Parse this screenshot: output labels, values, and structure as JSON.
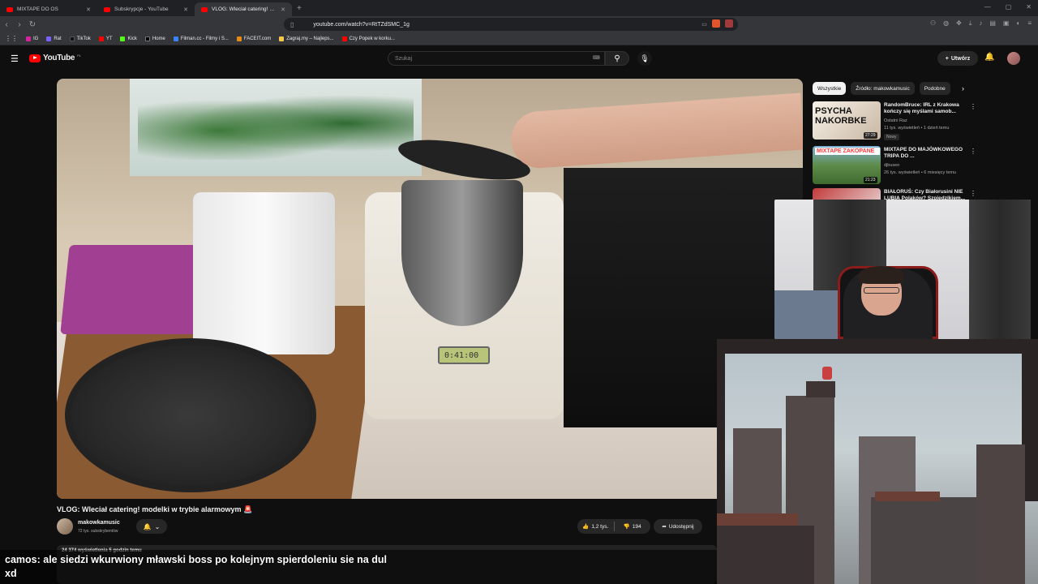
{
  "browser": {
    "tabs": [
      {
        "label": "MIXTAPE DO OS",
        "active": false
      },
      {
        "label": "Subskrypcje - YouTube",
        "active": false
      },
      {
        "label": "VLOG: Wleciał catering! mod...",
        "active": true
      }
    ],
    "url": "youtube.com/watch?v=RtTZdSMC_1g",
    "bookmarks": [
      "IG",
      "Rat",
      "TikTok",
      "YT",
      "Kick",
      "Home",
      "Filman.cc - Filmy i S...",
      "FACEIT.com",
      "Zagraj.my – Najleps...",
      "Czy Popek w korku..."
    ]
  },
  "youtube": {
    "logo": "YouTube",
    "country": "PL",
    "search_placeholder": "Szukaj",
    "create_label": "Utwórz"
  },
  "video": {
    "title": "VLOG: Wleciał catering! modelki w trybie alarmowym 🚨",
    "channel": "makowkamusic",
    "subscribers": "72 tys. subskrybentów",
    "likes": "1,2 tys.",
    "dislikes": "194",
    "share_label": "Udostępnij",
    "meta": "24 374 wyświetlenia  5 godzin temu",
    "display_readout": "0:41:00"
  },
  "sidebar": {
    "chips": [
      "Wszystkie",
      "Źródło: makowkamusic",
      "Podobne"
    ],
    "recommendations": [
      {
        "title": "RandomBruce: IRL z Krakowa kończy się myślami samob...",
        "channel": "Ostatni Raz",
        "meta": "11 tys. wyświetleń • 1 dzień temu",
        "badge": "Nowy",
        "duration": "27:29",
        "thumb_text": "PSYCHA NAKORBKE"
      },
      {
        "title": "MIXTAPE DO MAJÓWKOWEGO TRIPA DO ...",
        "channel": "djbusen",
        "meta": "26 tys. wyświetleń • 6 miesięcy temu",
        "badge": "",
        "duration": "21:23",
        "thumb_text": "MIXTAPE ZAKOPANE"
      },
      {
        "title": "BIAŁORUŚ: Czy Białorusini NIE LUBIĄ Polaków? Szpiedzikiem...",
        "channel": "",
        "meta": "",
        "badge": "",
        "duration": "",
        "thumb_text": ""
      }
    ]
  },
  "chat": {
    "user": "camos",
    "message": ": ale siedzi wkurwiony mławski boss po kolejnym spierdoleniu sie na dul",
    "message2": "xd"
  }
}
